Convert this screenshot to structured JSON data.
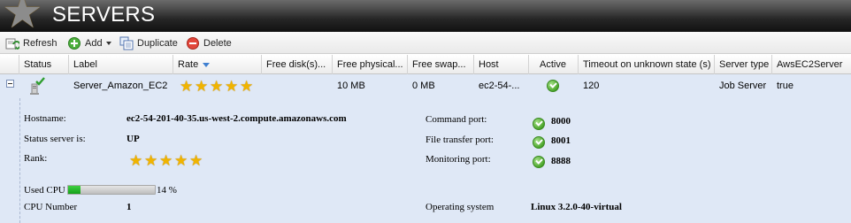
{
  "header": {
    "title": "SERVERS"
  },
  "toolbar": {
    "refresh_label": "Refresh",
    "add_label": "Add",
    "duplicate_label": "Duplicate",
    "delete_label": "Delete"
  },
  "grid": {
    "columns": [
      "Status",
      "Label",
      "Rate",
      "Free disk(s)...",
      "Free physical...",
      "Free swap...",
      "Host",
      "Active",
      "Timeout on unknown state (s)",
      "Server type",
      "AwsEC2Server"
    ],
    "sort_column": "Rate",
    "sort_direction": "descending",
    "row": {
      "label": "Server_Amazon_EC2",
      "rate_stars": 5,
      "free_disks": "",
      "free_physical": "10 MB",
      "free_swap": "0 MB",
      "host": "ec2-54-...",
      "active": true,
      "timeout": "120",
      "server_type": "Job Server",
      "aws_ec2_server": "true"
    }
  },
  "details": {
    "hostname_label": "Hostname:",
    "hostname_value": "ec2-54-201-40-35.us-west-2.compute.amazonaws.com",
    "status_label": "Status server is:",
    "status_value": "UP",
    "rank_label": "Rank:",
    "rank_stars": 5,
    "used_cpu_label": "Used CPU",
    "used_cpu_percent": 14,
    "used_cpu_text": "14 %",
    "cpu_number_label": "CPU Number",
    "cpu_number_value": "1",
    "command_port_label": "Command port:",
    "command_port_value": "8000",
    "file_transfer_port_label": "File transfer port:",
    "file_transfer_port_value": "8001",
    "monitoring_port_label": "Monitoring port:",
    "monitoring_port_value": "8888",
    "os_label": "Operating system",
    "os_value": "Linux 3.2.0-40-virtual"
  },
  "icons": {
    "header": "star-icon",
    "refresh": "refresh-icon",
    "add": "add-icon",
    "duplicate": "duplicate-icon",
    "delete": "delete-icon",
    "status": "server-ok-icon",
    "active": "check-circle-icon",
    "rate": "star-icon"
  },
  "colors": {
    "header_bg": "#262626",
    "row_selected_bg": "#dfe8f6",
    "star": "#f0b400",
    "ok_green": "#4aa52a",
    "cpu_fill": "#14a019",
    "sort_arrow": "#3f7fd0"
  }
}
